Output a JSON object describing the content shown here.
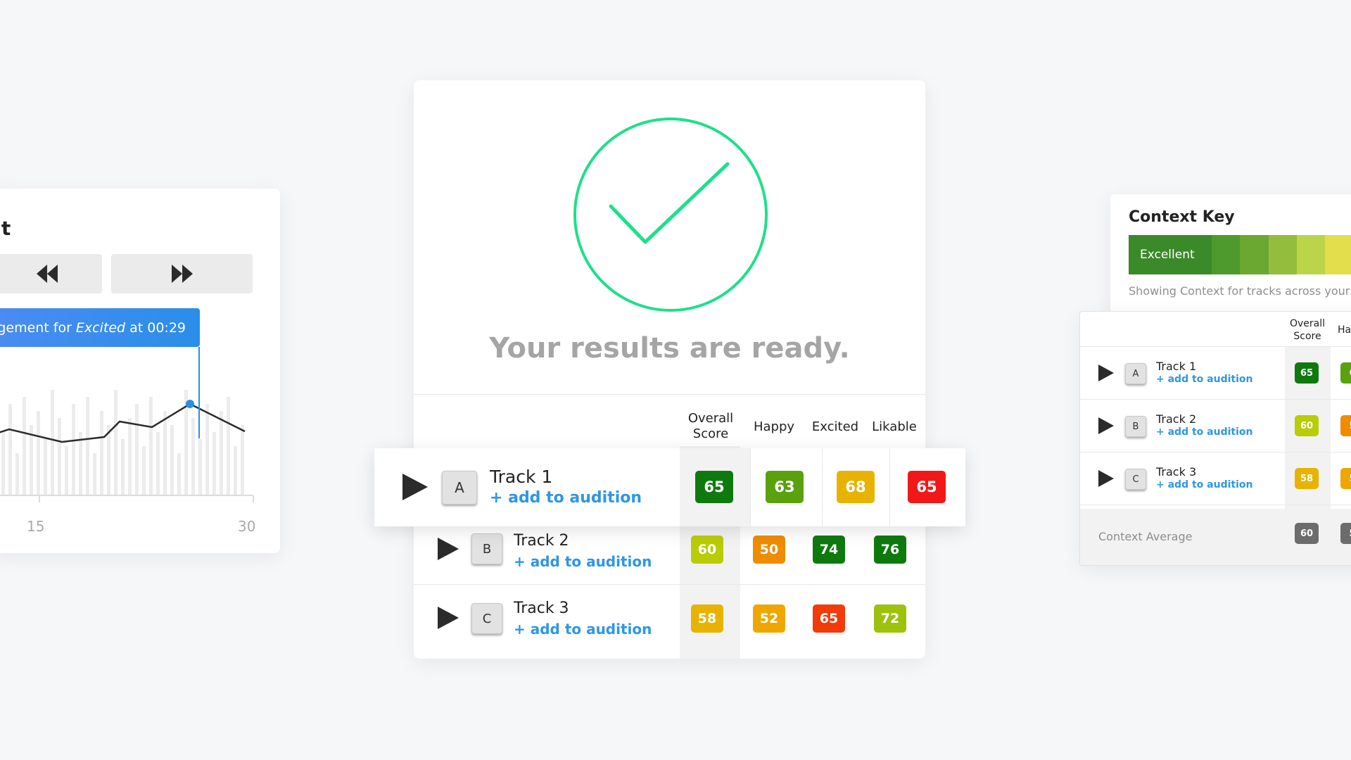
{
  "engagement_panel": {
    "title_fragment": "nt",
    "rewind_icon": "rewind-icon",
    "forward_icon": "fast-forward-icon",
    "tooltip": {
      "prefix": "gagement for",
      "emotion": "Excited",
      "suffix": "at 00:29"
    },
    "x_ticks": [
      "15",
      "30"
    ],
    "accent": "#2a8ee8"
  },
  "results": {
    "check_icon": "check-circle-icon",
    "title": "Your results are ready.",
    "columns": [
      "Overall Score",
      "Happy",
      "Excited",
      "Likable"
    ],
    "tracks": [
      {
        "letter": "A",
        "name": "Track 1",
        "add": "+ add to audition",
        "scores": [
          {
            "value": "65",
            "color": "#0e7a0e"
          },
          {
            "value": "63",
            "color": "#5aa10e"
          },
          {
            "value": "68",
            "color": "#e8b300"
          },
          {
            "value": "65",
            "color": "#f21818"
          }
        ]
      },
      {
        "letter": "B",
        "name": "Track 2",
        "add": "+ add to audition",
        "scores": [
          {
            "value": "60",
            "color": "#b8cd05"
          },
          {
            "value": "50",
            "color": "#ef8c00"
          },
          {
            "value": "74",
            "color": "#0e7a0e"
          },
          {
            "value": "76",
            "color": "#0e7a0e"
          }
        ]
      },
      {
        "letter": "C",
        "name": "Track 3",
        "add": "+ add to audition",
        "scores": [
          {
            "value": "58",
            "color": "#e8b300"
          },
          {
            "value": "52",
            "color": "#efa700"
          },
          {
            "value": "65",
            "color": "#f23a0a"
          },
          {
            "value": "72",
            "color": "#9dc20c"
          }
        ]
      }
    ]
  },
  "context_key": {
    "title": "Context Key",
    "scale_first_label": "Excellent",
    "scale_colors": [
      "#3a8a2a",
      "#4f9a2c",
      "#6aa832",
      "#93bd3c",
      "#bcd44a",
      "#e2de4c",
      "#e4b648",
      "#e07a2a"
    ],
    "caption": "Showing Context for tracks across your ca"
  },
  "context_table": {
    "columns": [
      "Overall Score",
      "Ha"
    ],
    "tracks": [
      {
        "letter": "A",
        "name": "Track 1",
        "add": "+ add to audition",
        "scores": [
          {
            "value": "65",
            "color": "#0e7a0e"
          },
          {
            "value": "6",
            "color": "#5aa10e"
          }
        ]
      },
      {
        "letter": "B",
        "name": "Track 2",
        "add": "+ add to audition",
        "scores": [
          {
            "value": "60",
            "color": "#b8cd05"
          },
          {
            "value": "5",
            "color": "#ef8c00"
          }
        ]
      },
      {
        "letter": "C",
        "name": "Track 3",
        "add": "+ add to audition",
        "scores": [
          {
            "value": "58",
            "color": "#e8b300"
          },
          {
            "value": "5",
            "color": "#efa700"
          }
        ]
      }
    ],
    "average_label": "Context Average",
    "average_scores": [
      {
        "value": "60",
        "color": "#6c6c6c"
      },
      {
        "value": "5",
        "color": "#6c6c6c"
      }
    ]
  }
}
